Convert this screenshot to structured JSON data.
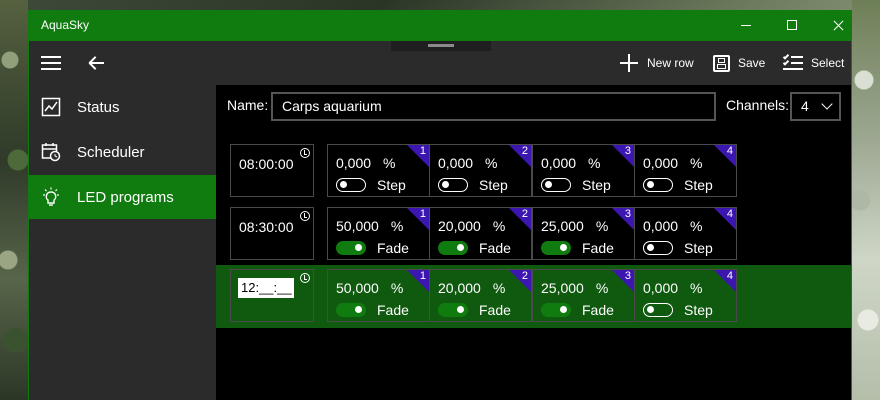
{
  "window": {
    "title": "AquaSky"
  },
  "toolbar": {
    "new_row": "New row",
    "save": "Save",
    "select": "Select"
  },
  "sidebar": {
    "items": [
      {
        "label": "Status",
        "icon": "status-chart-icon"
      },
      {
        "label": "Scheduler",
        "icon": "calendar-clock-icon"
      },
      {
        "label": "LED programs",
        "icon": "light-bulb-icon",
        "selected": true
      }
    ]
  },
  "program": {
    "name_label": "Name:",
    "name_value": "Carps aquarium",
    "channels_label": "Channels:",
    "channels_value": "4"
  },
  "rows": [
    {
      "time": "08:00:00",
      "channels": [
        {
          "num": "1",
          "value": "0,000",
          "unit": "%",
          "mode": "Step",
          "on": false
        },
        {
          "num": "2",
          "value": "0,000",
          "unit": "%",
          "mode": "Step",
          "on": false
        },
        {
          "num": "3",
          "value": "0,000",
          "unit": "%",
          "mode": "Step",
          "on": false
        },
        {
          "num": "4",
          "value": "0,000",
          "unit": "%",
          "mode": "Step",
          "on": false
        }
      ]
    },
    {
      "time": "08:30:00",
      "channels": [
        {
          "num": "1",
          "value": "50,000",
          "unit": "%",
          "mode": "Fade",
          "on": true
        },
        {
          "num": "2",
          "value": "20,000",
          "unit": "%",
          "mode": "Fade",
          "on": true
        },
        {
          "num": "3",
          "value": "25,000",
          "unit": "%",
          "mode": "Fade",
          "on": true
        },
        {
          "num": "4",
          "value": "0,000",
          "unit": "%",
          "mode": "Step",
          "on": false
        }
      ]
    },
    {
      "time": "12:__:__",
      "editing": true,
      "channels": [
        {
          "num": "1",
          "value": "50,000",
          "unit": "%",
          "mode": "Fade",
          "on": true
        },
        {
          "num": "2",
          "value": "20,000",
          "unit": "%",
          "mode": "Fade",
          "on": true
        },
        {
          "num": "3",
          "value": "25,000",
          "unit": "%",
          "mode": "Fade",
          "on": true
        },
        {
          "num": "4",
          "value": "0,000",
          "unit": "%",
          "mode": "Step",
          "on": false
        }
      ]
    }
  ],
  "colors": {
    "accent": "#107c10",
    "channel_badge": "#3c16b0",
    "chrome": "#2b2b2b"
  }
}
